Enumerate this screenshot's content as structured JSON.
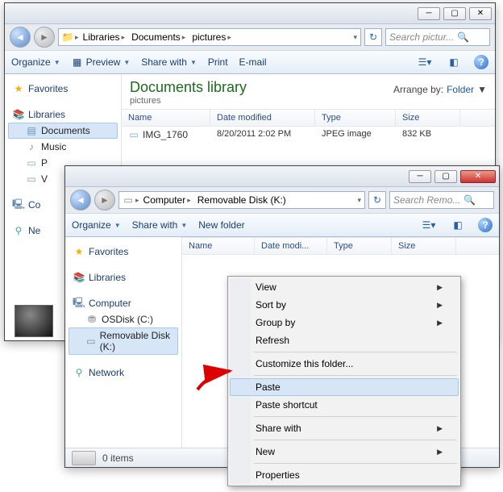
{
  "window1": {
    "breadcrumbs": [
      "Libraries",
      "Documents",
      "pictures"
    ],
    "search_placeholder": "Search pictur...",
    "toolbar": {
      "organize": "Organize",
      "preview": "Preview",
      "share": "Share with",
      "print": "Print",
      "email": "E-mail"
    },
    "nav": {
      "favorites": "Favorites",
      "libraries": "Libraries",
      "documents": "Documents",
      "music": "Music",
      "pictures": "P",
      "videos": "V",
      "computer_short": "Co",
      "network_short": "Ne"
    },
    "content": {
      "title": "Documents library",
      "subtitle": "pictures",
      "arrange_label": "Arrange by:",
      "arrange_value": "Folder",
      "columns": {
        "name": "Name",
        "date": "Date modified",
        "type": "Type",
        "size": "Size"
      },
      "rows": [
        {
          "name": "IMG_1760",
          "date": "8/20/2011 2:02 PM",
          "type": "JPEG image",
          "size": "832 KB"
        }
      ]
    }
  },
  "window2": {
    "breadcrumbs": [
      "Computer",
      "Removable Disk (K:)"
    ],
    "search_placeholder": "Search Remo...",
    "toolbar": {
      "organize": "Organize",
      "share": "Share with",
      "newfolder": "New folder"
    },
    "nav": {
      "favorites": "Favorites",
      "libraries": "Libraries",
      "computer": "Computer",
      "osdisk": "OSDisk (C:)",
      "removable": "Removable Disk (K:)",
      "network": "Network"
    },
    "content": {
      "columns": {
        "name": "Name",
        "date": "Date modi...",
        "type": "Type",
        "size": "Size"
      }
    },
    "status": {
      "items": "0 items"
    }
  },
  "context_menu": {
    "view": "View",
    "sortby": "Sort by",
    "groupby": "Group by",
    "refresh": "Refresh",
    "customize": "Customize this folder...",
    "paste": "Paste",
    "paste_shortcut": "Paste shortcut",
    "sharewith": "Share with",
    "new": "New",
    "properties": "Properties"
  }
}
